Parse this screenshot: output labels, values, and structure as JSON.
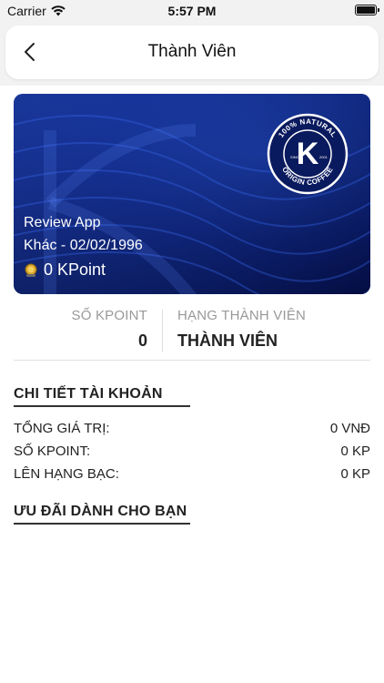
{
  "status_bar": {
    "carrier": "Carrier",
    "time": "5:57 PM"
  },
  "header": {
    "title": "Thành Viên",
    "back_icon": "chevron-left-icon"
  },
  "member_card": {
    "brand_logo_text": "100% NATURAL · ORIGIN COFFEE · SINCE 2001",
    "brand_letter": "K",
    "name": "Review App",
    "dob_line": "Khác - 02/02/1996",
    "points_text": "0 KPoint",
    "colors": {
      "background": "#0a1f7a",
      "accent": "#1a3fb0"
    }
  },
  "stats": {
    "kpoint_label": "SỐ KPOINT",
    "kpoint_value": "0",
    "rank_label": "HẠNG THÀNH VIÊN",
    "rank_value": "THÀNH VIÊN"
  },
  "account_details": {
    "title": "CHI TIẾT TÀI KHOẢN",
    "rows": [
      {
        "label": "TỔNG GIÁ TRỊ:",
        "value": "0 VNĐ"
      },
      {
        "label": "SỐ KPOINT:",
        "value": "0 KP"
      },
      {
        "label": "LÊN HẠNG BẠC:",
        "value": "0 KP"
      }
    ]
  },
  "offers": {
    "title": "ƯU ĐÃI DÀNH CHO BẠN"
  }
}
